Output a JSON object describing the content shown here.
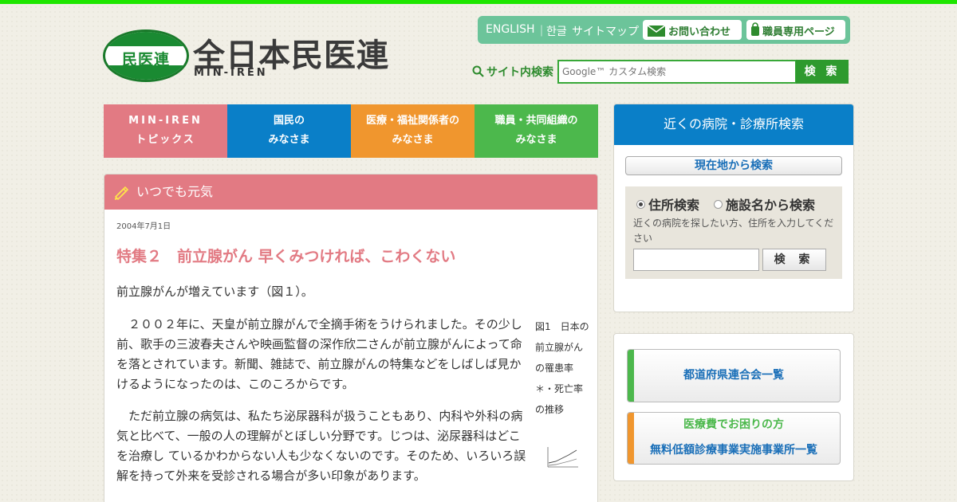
{
  "site": {
    "logo_mark": "民医連",
    "logo_title": "全日本民医連",
    "logo_sub": "MIN-IREN"
  },
  "toplinks": {
    "english": "ENGLISH",
    "sep": "｜",
    "korean": "한글",
    "sitemap": "サイトマップ",
    "contact": "お問い合わせ",
    "staff": "職員専用ページ"
  },
  "search": {
    "label": "サイト内検索",
    "placeholder": "Google™ カスタム検索",
    "button": "検 索"
  },
  "nav": [
    {
      "line1": "MIN-IREN",
      "line2": "トピックス",
      "color": "#e27a83"
    },
    {
      "line1": "国民の",
      "line2": "みなさま",
      "color": "#0a7fc8"
    },
    {
      "line1": "医療・福祉関係者の",
      "line2": "みなさま",
      "color": "#f0962e"
    },
    {
      "line1": "職員・共同組織の",
      "line2": "みなさま",
      "color": "#4cb84c"
    }
  ],
  "article": {
    "section": "いつでも元気",
    "date": "2004年7月1日",
    "title": "特集２　前立腺がん 早くみつければ、こわくない",
    "lead": "前立腺がんが増えています（図１）。",
    "para1": "２００２年に、天皇が前立腺がんで全摘手術をうけられました。その少し前、歌手の三波春夫さんや映画監督の深作欣二さんが前立腺がんによって命を落とされています。新聞、雑誌で、前立腺がんの特集などをしばしば見かけるようになったのは、このころからです。",
    "para2": "ただ前立腺の病気は、私たち泌尿器科が扱うこともあり、内科や外科の病気と比べて、一般の人の理解がとぼしい分野です。じつは、泌尿器科はどこを治療し ているかわからない人も少なくないのです。そのため、いろいろ誤解を持って外来を受診される場合が多い印象があります。",
    "figure_caption": "図1　日本の前立腺がんの罹患率＊・死亡率の推移"
  },
  "hospital_search": {
    "title": "近くの病院・診療所検索",
    "locate_button": "現在地から検索",
    "radio_address": "住所検索",
    "radio_facility": "施設名から検索",
    "hint": "近くの病院を探したい方、住所を入力してください",
    "address_value": "",
    "button": "検 索"
  },
  "links": {
    "prefectures": "都道府県連合会一覧",
    "medical_cost_title": "医療費でお困りの方",
    "medical_cost_link": "無料低額診療事業実施事業所一覧"
  },
  "colors": {
    "accent_green": "#1ee600",
    "brand_green": "#2e9a2e",
    "pink": "#e27a83",
    "blue": "#0a7fc8",
    "orange": "#f0962e"
  }
}
